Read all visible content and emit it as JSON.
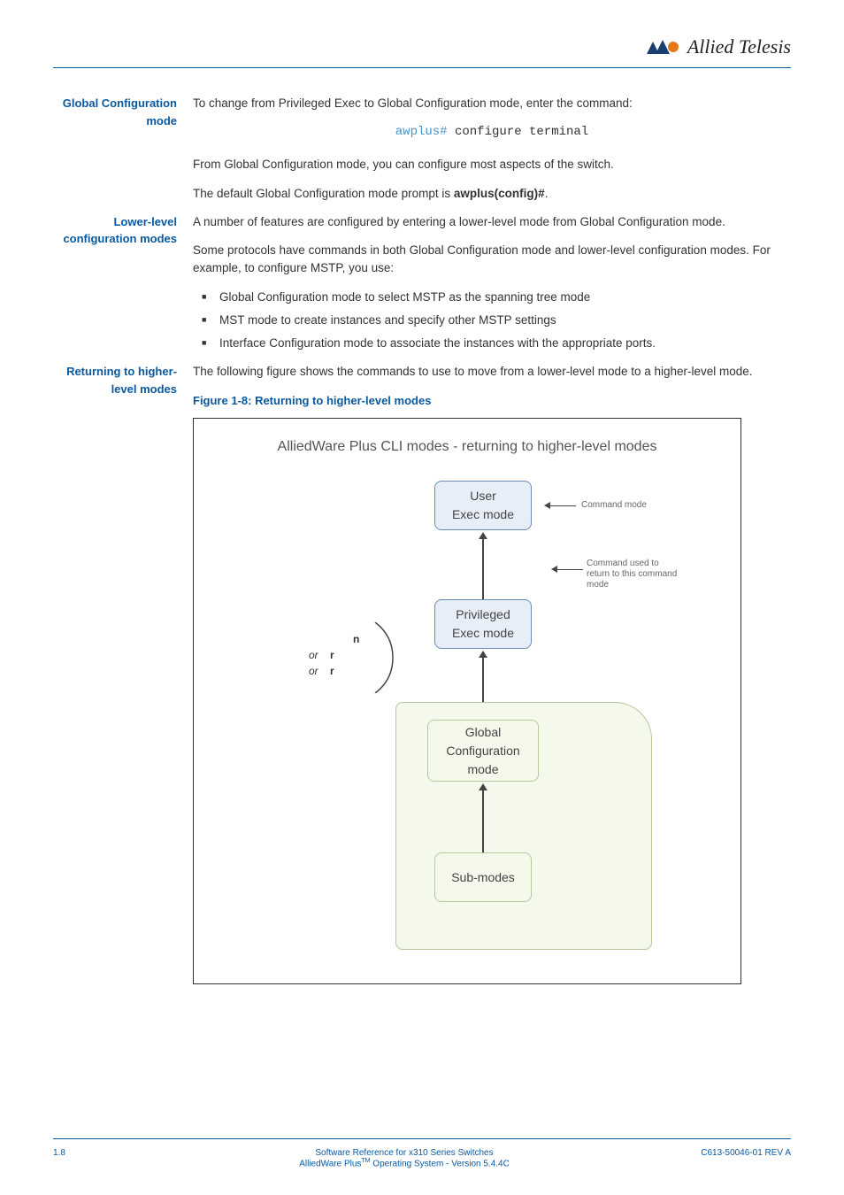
{
  "logo": {
    "text": "Allied Telesis"
  },
  "sections": {
    "globalConfig": {
      "label": "Global Configuration mode",
      "p1": "To change from Privileged Exec to Global Configuration mode, enter the command:",
      "cmd_prompt": "awplus#",
      "cmd_text": " configure terminal",
      "p2": "From Global Configuration mode, you can configure most aspects of the switch.",
      "p3_pre": "The default Global Configuration mode prompt is ",
      "p3_bold": "awplus(config)#",
      "p3_post": "."
    },
    "lowerLevel": {
      "label": "Lower-level configuration modes",
      "p1": "A number of features are configured by entering a lower-level mode from Global Configuration mode.",
      "p2": "Some protocols have commands in both Global Configuration mode and lower-level configuration modes. For example, to configure MSTP, you use:",
      "bullets": [
        "Global Configuration mode to select MSTP as the spanning tree mode",
        "MST mode to create instances and specify other MSTP settings",
        "Interface Configuration mode to associate the instances with the appropriate ports."
      ]
    },
    "returning": {
      "label": "Returning to higher-level modes",
      "p1": "The following figure shows the commands to use to move from a lower-level mode to a higher-level mode.",
      "fig_caption": "Figure 1-8: Returning to higher-level modes"
    }
  },
  "diagram": {
    "title": "AlliedWare Plus CLI modes - returning to higher-level modes",
    "box_user": "User\nExec mode",
    "box_priv": "Privileged\nExec mode",
    "box_global": "Global\nConfiguration\nmode",
    "box_sub": "Sub-modes",
    "legend1": "Command mode",
    "legend2": "Command used to return to this command mode",
    "center_n": "n",
    "center_or1": "or",
    "center_r1": "r",
    "center_or2": "or",
    "center_r2": "r"
  },
  "footer": {
    "page_num": "1.8",
    "line1": "Software Reference for x310 Series Switches",
    "line2_pre": "AlliedWare Plus",
    "line2_sup": "TM",
    "line2_post": " Operating System  - Version 5.4.4C",
    "rev": "C613-50046-01 REV A"
  }
}
